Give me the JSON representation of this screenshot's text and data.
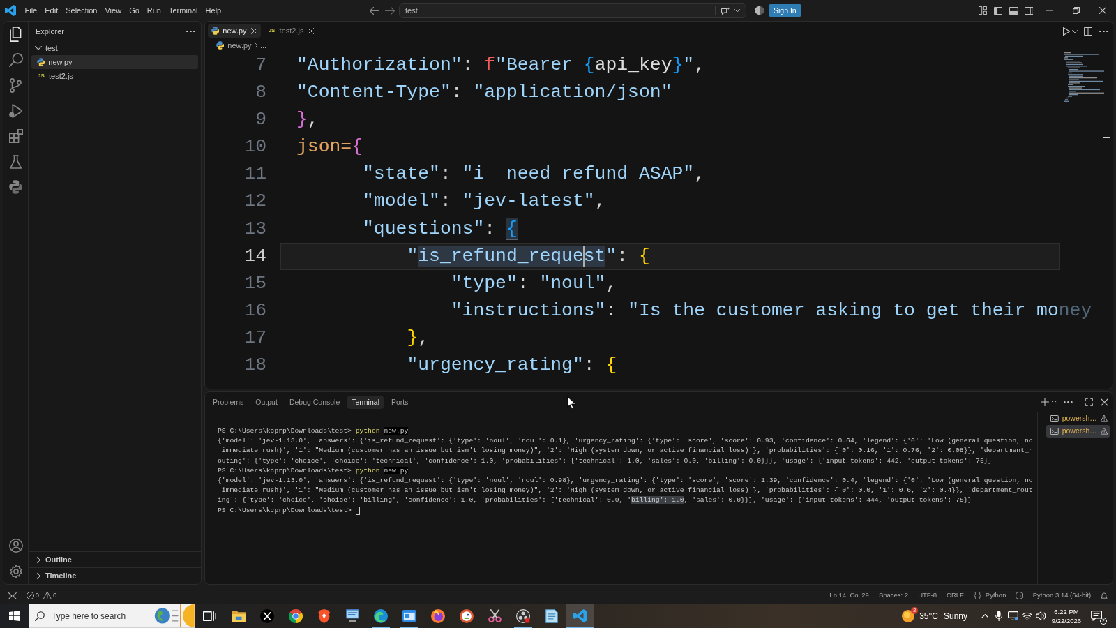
{
  "title_bar": {
    "menu": [
      "File",
      "Edit",
      "Selection",
      "View",
      "Go",
      "Run",
      "Terminal",
      "Help"
    ],
    "command_center": "test",
    "sign_in": "Sign In"
  },
  "activity_bar": {
    "top": [
      {
        "kind": "files",
        "selected": true
      },
      {
        "kind": "search",
        "selected": false
      },
      {
        "kind": "source_control",
        "selected": false
      },
      {
        "kind": "run_debug",
        "selected": false
      },
      {
        "kind": "extensions",
        "selected": false
      },
      {
        "kind": "testing",
        "selected": false
      },
      {
        "kind": "python",
        "selected": false
      }
    ],
    "bottom": [
      {
        "kind": "account"
      },
      {
        "kind": "settings"
      }
    ]
  },
  "sidebar": {
    "title": "Explorer",
    "tree": [
      {
        "label": "test",
        "expanded": true,
        "selected": false,
        "children": [
          {
            "label": "new.py",
            "kind": "python",
            "selected": true
          },
          {
            "label": "test2.js",
            "kind": "javascript",
            "icon_text": "JS",
            "selected": false
          }
        ]
      }
    ],
    "sections": [
      {
        "label": "Outline",
        "expanded": false
      },
      {
        "label": "Timeline",
        "expanded": false
      }
    ]
  },
  "editor": {
    "tabs": [
      {
        "label": "new.py",
        "kind": "python",
        "selected": true
      },
      {
        "label": "test2.js",
        "kind": "javascript",
        "icon_text": "JS",
        "selected": false
      }
    ],
    "breadcrumb": [
      {
        "label": "new.py",
        "kind": "python"
      },
      {
        "label": "...",
        "kind": "symbol"
      }
    ],
    "lines": [
      {
        "number": "7",
        "current": false,
        "tokens": [
          {
            "kind": "string",
            "text": "\"Authorization\""
          },
          {
            "kind": "punct",
            "text": ": "
          },
          {
            "kind": "prefix",
            "text": "f"
          },
          {
            "kind": "string",
            "text": "\"Bearer "
          },
          {
            "kind": "bracket3",
            "text": "{"
          },
          {
            "kind": "name",
            "text": "api_key"
          },
          {
            "kind": "bracket3",
            "text": "}"
          },
          {
            "kind": "string",
            "text": "\""
          },
          {
            "kind": "punct",
            "text": ","
          }
        ]
      },
      {
        "number": "8",
        "current": false,
        "tokens": [
          {
            "kind": "string",
            "text": "\"Content-Type\""
          },
          {
            "kind": "punct",
            "text": ": "
          },
          {
            "kind": "string",
            "text": "\"application/json\""
          }
        ]
      },
      {
        "number": "9",
        "current": false,
        "tokens": [
          {
            "kind": "bracket2",
            "text": "}"
          },
          {
            "kind": "punct",
            "text": ","
          }
        ]
      },
      {
        "number": "10",
        "current": false,
        "tokens": [
          {
            "kind": "param",
            "text": "json="
          },
          {
            "kind": "bracket2",
            "text": "{"
          }
        ]
      },
      {
        "number": "11",
        "current": false,
        "tokens": [
          {
            "kind": "string",
            "text": "      \"state\""
          },
          {
            "kind": "punct",
            "text": ": "
          },
          {
            "kind": "string",
            "text": "\"i  need refund ASAP\""
          },
          {
            "kind": "punct",
            "text": ","
          }
        ]
      },
      {
        "number": "12",
        "current": false,
        "tokens": [
          {
            "kind": "string",
            "text": "      \"model\""
          },
          {
            "kind": "punct",
            "text": ": "
          },
          {
            "kind": "string",
            "text": "\"jev-latest\""
          },
          {
            "kind": "punct",
            "text": ","
          }
        ]
      },
      {
        "number": "13",
        "current": false,
        "tokens": [
          {
            "kind": "string",
            "text": "      \"questions\""
          },
          {
            "kind": "punct",
            "text": ": "
          },
          {
            "kind": "match",
            "text": "{"
          }
        ]
      },
      {
        "number": "14",
        "current": true,
        "tokens": [
          {
            "kind": "string",
            "text": "          \""
          },
          {
            "kind": "occurrence",
            "text": "is_refund_reque"
          },
          {
            "kind": "caret"
          },
          {
            "kind": "occurrence",
            "text": "st"
          },
          {
            "kind": "string",
            "text": "\""
          },
          {
            "kind": "punct",
            "text": ": "
          },
          {
            "kind": "bracket1",
            "text": "{"
          }
        ]
      },
      {
        "number": "15",
        "current": false,
        "tokens": [
          {
            "kind": "string",
            "text": "              \"type\""
          },
          {
            "kind": "punct",
            "text": ": "
          },
          {
            "kind": "string",
            "text": "\"noul\""
          },
          {
            "kind": "punct",
            "text": ","
          }
        ]
      },
      {
        "number": "16",
        "current": false,
        "tokens": [
          {
            "kind": "string",
            "text": "              \"instructions\""
          },
          {
            "kind": "punct",
            "text": ": "
          },
          {
            "kind": "string",
            "text": "\"Is the customer asking to get their mo"
          },
          {
            "kind": "faded",
            "text": "ney"
          }
        ]
      },
      {
        "number": "17",
        "current": false,
        "tokens": [
          {
            "kind": "bracket1",
            "text": "          }"
          },
          {
            "kind": "punct",
            "text": ","
          }
        ]
      },
      {
        "number": "18",
        "current": false,
        "tokens": [
          {
            "kind": "string",
            "text": "          \"urgency_rating\""
          },
          {
            "kind": "punct",
            "text": ": "
          },
          {
            "kind": "bracket1",
            "text": "{"
          }
        ]
      }
    ]
  },
  "panel": {
    "tabs": [
      {
        "label": "Problems",
        "selected": false
      },
      {
        "label": "Output",
        "selected": false
      },
      {
        "label": "Debug Console",
        "selected": false
      },
      {
        "label": "Terminal",
        "selected": true
      },
      {
        "label": "Ports",
        "selected": false
      }
    ],
    "terminal_lines": [
      {
        "kind": "command",
        "prompt": "PS C:\\Users\\kcprp\\Downloads\\test>",
        "program": "python",
        "args": "new.py"
      },
      {
        "kind": "output",
        "segments": [
          {
            "text": "{'model': 'jev-1.13.0', 'answers': {'is_refund_request': {'type': 'noul', 'noul': 0.1}, 'urgency_rating': {'type': 'score', 'score': 0.93, 'confidence': 0.64, 'legend': {'0': 'Low (general question, no",
            "highlighted": false
          }
        ]
      },
      {
        "kind": "output",
        "segments": [
          {
            "text": " immediate rush)', '1': \"Medium (customer has an issue but isn't losing money)\", '2': 'High (system down, or active financial loss)'}, 'probabilities': {'0': 0.16, '1': 0.76, '2': 0.08}}, 'department_r",
            "highlighted": false
          }
        ]
      },
      {
        "kind": "output",
        "segments": [
          {
            "text": "outing': {'type': 'choice', 'choice': 'technical', 'confidence': 1.0, 'probabilities': {'technical': 1.0, 'sales': 0.0, 'billing': 0.0}}}, 'usage': {'input_tokens': 442, 'output_tokens': 75}}",
            "highlighted": false
          }
        ]
      },
      {
        "kind": "command",
        "prompt": "PS C:\\Users\\kcprp\\Downloads\\test>",
        "program": "python",
        "args": "new.py"
      },
      {
        "kind": "output",
        "segments": [
          {
            "text": "{'model': 'jev-1.13.0', 'answers': {'is_refund_request': {'type': 'noul', 'noul': 0.98}, 'urgency_rating': {'type': 'score', 'score': 1.39, 'confidence': 0.4, 'legend': {'0': 'Low (general question, no",
            "highlighted": false
          }
        ]
      },
      {
        "kind": "output",
        "segments": [
          {
            "text": " immediate rush)', '1': \"Medium (customer has an issue but isn't losing money)\", '2': 'High (system down, or active financial loss)'}, 'probabilities': {'0': 0.0, '1': 0.6, '2': 0.4}}, 'department_rout",
            "highlighted": false
          }
        ]
      },
      {
        "kind": "output",
        "segments": [
          {
            "text": "ing': {'type': 'choice', 'choice': 'billing', 'confidence': 1.0, 'probabilities': {'technical': 0.0, '",
            "highlighted": false
          },
          {
            "text": "billing': 1.0",
            "highlighted": true
          },
          {
            "text": ", 'sales': 0.0}}}, 'usage': {'input_tokens': 444, 'output_tokens': 75}}",
            "highlighted": false
          }
        ]
      },
      {
        "kind": "prompt",
        "prompt": "PS C:\\Users\\kcprp\\Downloads\\test>",
        "cursor": true
      }
    ],
    "sessions": [
      {
        "label": "powersh…",
        "warning": true,
        "selected": false
      },
      {
        "label": "powersh…",
        "warning": true,
        "selected": true
      }
    ]
  },
  "status_bar": {
    "problems": [
      {
        "kind": "error",
        "count": "0"
      },
      {
        "kind": "warning",
        "count": "0"
      }
    ],
    "items": [
      {
        "kind": "text",
        "label": "Ln 14, Col 29"
      },
      {
        "kind": "text",
        "label": "Spaces: 2"
      },
      {
        "kind": "text",
        "label": "UTF-8"
      },
      {
        "kind": "text",
        "label": "CRLF"
      },
      {
        "kind": "language",
        "label": "Python"
      },
      {
        "kind": "copilot"
      },
      {
        "kind": "text",
        "label": "Python 3.14 (64-bit)"
      },
      {
        "kind": "notifications"
      }
    ]
  },
  "taskbar": {
    "search": {
      "placeholder": "Type here to search"
    },
    "apps": [
      {
        "kind": "task_view",
        "running": false,
        "active": false
      },
      {
        "kind": "file_explorer",
        "running": false,
        "active": false
      },
      {
        "kind": "x",
        "running": false,
        "active": false
      },
      {
        "kind": "chrome",
        "running": false,
        "active": false
      },
      {
        "kind": "brave",
        "running": false,
        "active": false
      },
      {
        "kind": "computer",
        "running": false,
        "active": false
      },
      {
        "kind": "edge",
        "running": true,
        "active": false
      },
      {
        "kind": "window_app",
        "running": true,
        "active": false
      },
      {
        "kind": "firefox",
        "running": false,
        "active": false
      },
      {
        "kind": "duckduckgo",
        "running": false,
        "active": false
      },
      {
        "kind": "snip",
        "running": false,
        "active": false
      },
      {
        "kind": "obs",
        "running": true,
        "active": false
      },
      {
        "kind": "notepad",
        "running": false,
        "active": false
      },
      {
        "kind": "vscode",
        "running": true,
        "active": true
      }
    ],
    "weather": {
      "alerts": "2",
      "temperature": "35°C",
      "condition": "Sunny"
    },
    "tray": [
      {
        "kind": "chevron"
      },
      {
        "kind": "microphone"
      },
      {
        "kind": "display"
      },
      {
        "kind": "wifi"
      },
      {
        "kind": "volume"
      }
    ],
    "clock": {
      "time": "6:22 PM",
      "date": "9/22/2026"
    },
    "notifications": {
      "count": "2"
    }
  }
}
